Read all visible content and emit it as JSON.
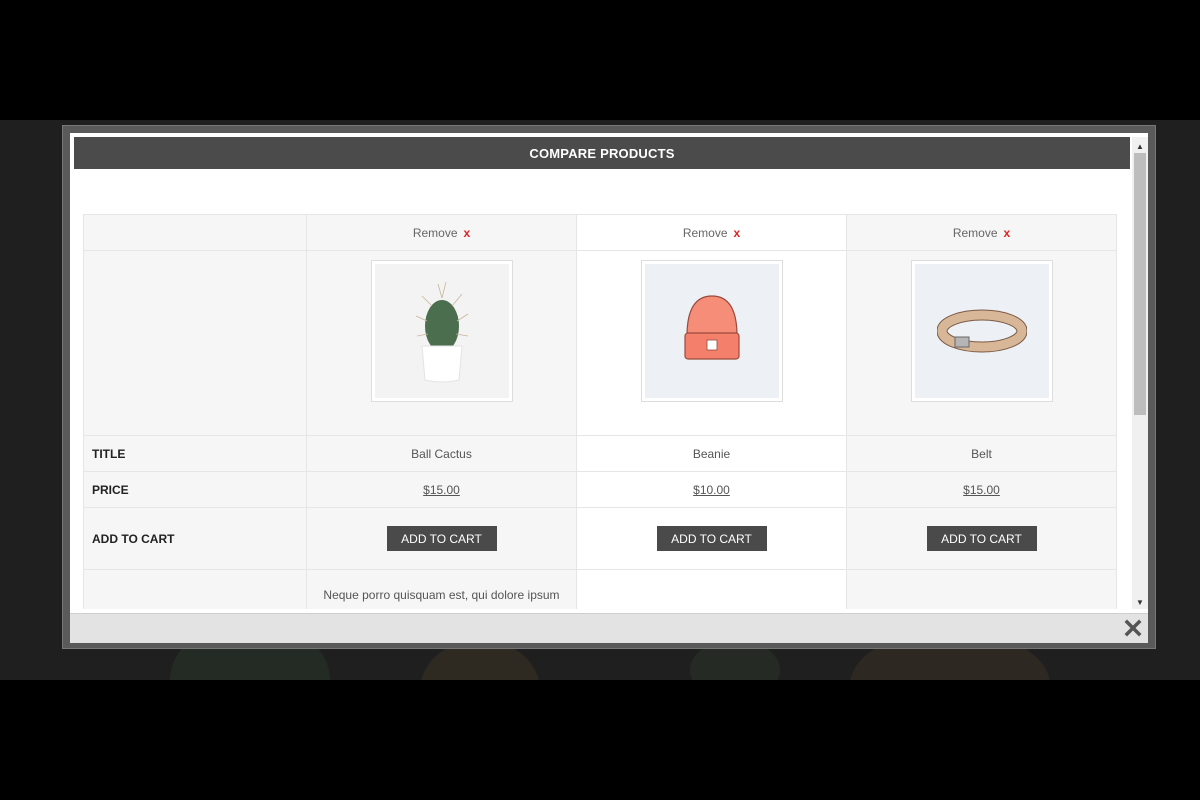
{
  "modal": {
    "title": "COMPARE PRODUCTS",
    "close_icon": "close-icon"
  },
  "compare": {
    "remove_label": "Remove",
    "remove_x": "x",
    "rows": {
      "title_label": "TITLE",
      "price_label": "PRICE",
      "add_to_cart_label": "ADD TO CART"
    },
    "products": [
      {
        "title": "Ball Cactus",
        "price": "$15.00",
        "button": "ADD TO CART",
        "image": "cactus",
        "description": "Neque porro quisquam est, qui dolore ipsum"
      },
      {
        "title": "Beanie",
        "price": "$10.00",
        "button": "ADD TO CART",
        "image": "beanie",
        "description": ""
      },
      {
        "title": "Belt",
        "price": "$15.00",
        "button": "ADD TO CART",
        "image": "belt",
        "description": ""
      }
    ]
  },
  "colors": {
    "header_bg": "#4b4b4b",
    "button_bg": "#4a4a4a",
    "remove_x": "#e02020"
  }
}
